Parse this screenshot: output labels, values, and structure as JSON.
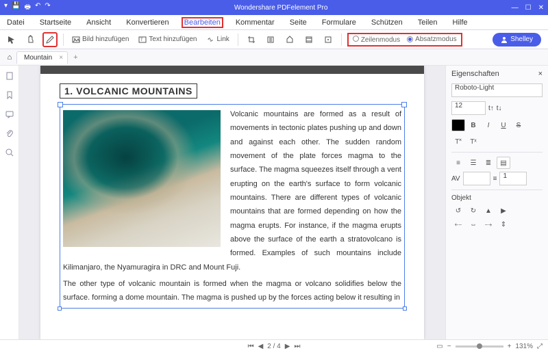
{
  "app": {
    "title": "Wondershare PDFelement Pro"
  },
  "menu": {
    "items": [
      "Datei",
      "Startseite",
      "Ansicht",
      "Konvertieren",
      "Bearbeiten",
      "Kommentar",
      "Seite",
      "Formulare",
      "Schützen",
      "Teilen",
      "Hilfe"
    ],
    "active_index": 4
  },
  "toolbar": {
    "add_image": "Bild hinzufügen",
    "add_text": "Text hinzufügen",
    "link": "Link",
    "mode_line": "Zeilenmodus",
    "mode_para": "Absatzmodus",
    "mode_selected": "para",
    "user": "Shelley"
  },
  "tabs": {
    "items": [
      {
        "label": "Mountain"
      }
    ]
  },
  "document": {
    "heading": "1. VOLCANIC MOUNTAINS",
    "para1": "Volcanic mountains are formed as a result of movements in tectonic plates pushing up and down and against each other. The sudden random movement of the plate forces magma to the surface. The magma squeezes itself through a vent erupting on the earth's surface to form volcanic mountains. There are different types of volcanic mountains that are formed depending on how the magma erupts. For instance, if the magma erupts above the surface of the earth a stratovolcano is formed. Examples of such mountains include Kilimanjaro, the Nyamuragira in DRC and Mount Fuji.",
    "para2": "The other type of volcanic mountain is formed when the magma or volcano solidifies below the surface. forming a dome mountain. The magma is pushed up by the forces acting below it resulting in"
  },
  "properties": {
    "title": "Eigenschaften",
    "font": "Roboto-Light",
    "size": "12",
    "object_title": "Objekt",
    "line_spacing": "1"
  },
  "status": {
    "page_current": "2",
    "page_total": "4",
    "zoom": "131%"
  }
}
